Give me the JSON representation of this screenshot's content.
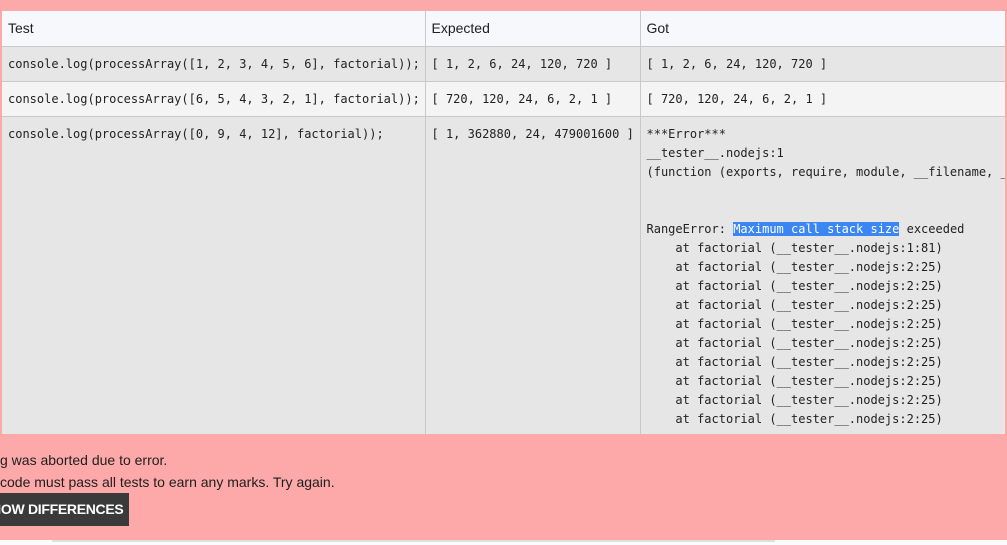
{
  "table": {
    "headers": [
      "Test",
      "Expected",
      "Got"
    ],
    "rows": [
      {
        "test": "console.log(processArray([1, 2, 3, 4, 5, 6], factorial));",
        "expected": "[ 1, 2, 6, 24, 120, 720 ]",
        "got": "[ 1, 2, 6, 24, 120, 720 ]"
      },
      {
        "test": "console.log(processArray([6, 5, 4, 3, 2, 1], factorial));",
        "expected": "[ 720, 120, 24, 6, 2, 1 ]",
        "got": "[ 720, 120, 24, 6, 2, 1 ]"
      },
      {
        "test": "console.log(processArray([0, 9, 4, 12], factorial));",
        "expected": "[ 1, 362880, 24, 479001600 ]",
        "got_lines": [
          "***Error***",
          "__tester__.nodejs:1",
          "(function (exports, require, module, __filename, __",
          "",
          "",
          "at factorial (__tester__.nodejs:1:81)",
          "at factorial (__tester__.nodejs:2:25)",
          "at factorial (__tester__.nodejs:2:25)",
          "at factorial (__tester__.nodejs:2:25)",
          "at factorial (__tester__.nodejs:2:25)",
          "at factorial (__tester__.nodejs:2:25)",
          "at factorial (__tester__.nodejs:2:25)",
          "at factorial (__tester__.nodejs:2:25)",
          "at factorial (__tester__.nodejs:2:25)",
          "at factorial (__tester__.nodejs:2:25)"
        ],
        "error_prefix": "RangeError: ",
        "error_highlight": "Maximum call stack size",
        "error_suffix": " exceeded"
      }
    ]
  },
  "messages": {
    "aborted": "g was aborted due to error.",
    "must_pass": "code must pass all tests to earn any marks. Try again."
  },
  "buttons": {
    "show_differences": "SHOW DIFFERENCES"
  },
  "colors": {
    "error_panel": "#fda9a9",
    "highlight": "#3b86f2",
    "button": "#3a3a3a"
  }
}
